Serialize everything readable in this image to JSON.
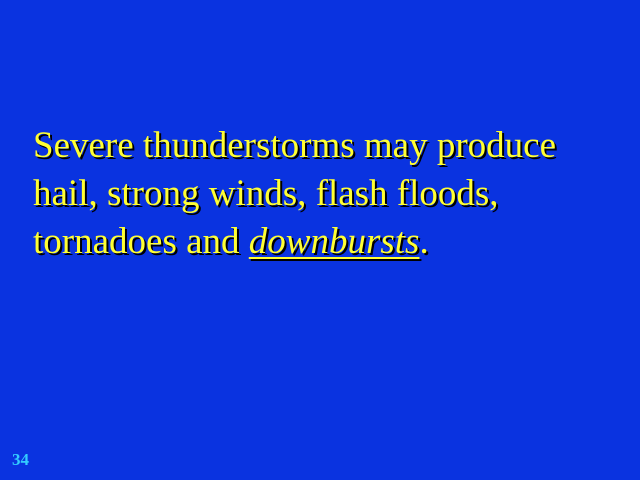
{
  "slide": {
    "lines": [
      "Severe thunderstorms may produce",
      "hail, strong winds, flash floods,"
    ],
    "line3_prefix": "tornadoes and ",
    "emphasis": "downbursts",
    "line3_suffix": ".",
    "page_number": "34"
  },
  "colors": {
    "background": "#0a33e0",
    "text": "#ffff33",
    "page_number": "#33ccff"
  }
}
